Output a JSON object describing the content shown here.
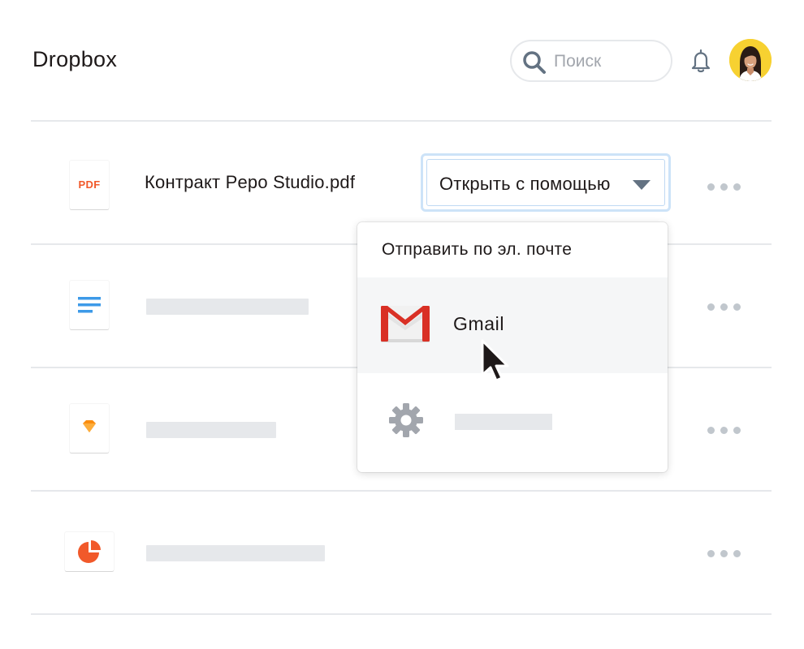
{
  "header": {
    "app_title": "Dropbox",
    "search_placeholder": "Поиск",
    "search_value": ""
  },
  "files": [
    {
      "name": "Контракт Pepo Studio.pdf",
      "type_label": "PDF",
      "icon": "pdf-file-icon"
    },
    {
      "name": "",
      "icon": "document-file-icon"
    },
    {
      "name": "",
      "icon": "sketch-file-icon"
    },
    {
      "name": "",
      "icon": "presentation-file-icon"
    }
  ],
  "open_with": {
    "label": "Открыть с помощью"
  },
  "share_menu": {
    "header": "Отправить по эл. почте",
    "items": [
      {
        "label": "Gmail",
        "icon": "gmail-icon"
      },
      {
        "label": "",
        "icon": "gear-icon"
      }
    ]
  },
  "colors": {
    "pdf_red": "#f1592a",
    "doc_blue": "#3d9ae8",
    "sketch_orange": "#fa8c0f",
    "slides_red": "#f1592a",
    "focus_ring": "#cde3f8",
    "avatar_bg": "#f7d131",
    "gmail_red": "#d93025"
  }
}
